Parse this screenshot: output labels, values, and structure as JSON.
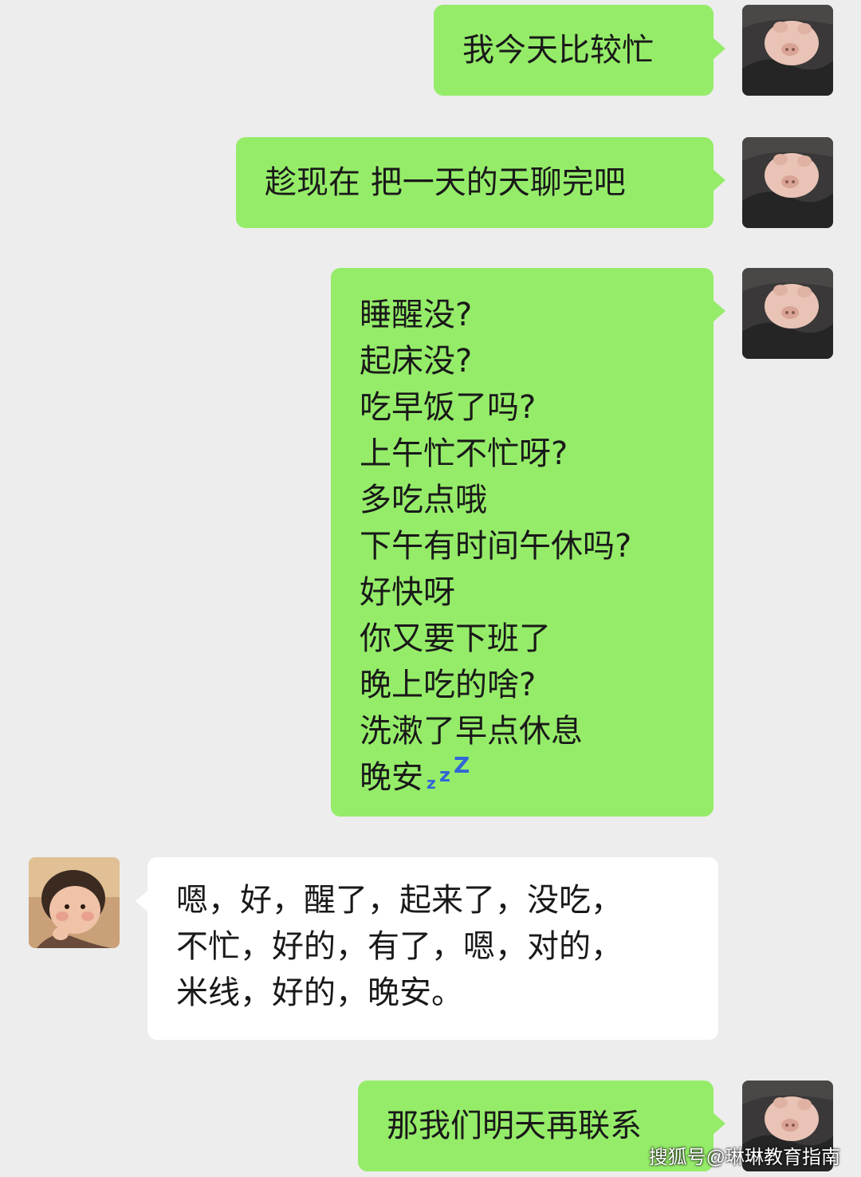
{
  "messages": [
    {
      "sender": "me",
      "text": "我今天比较忙"
    },
    {
      "sender": "me",
      "text": "趁现在 把一天的天聊完吧"
    },
    {
      "sender": "me",
      "lines": [
        "睡醒没?",
        "起床没?",
        "吃早饭了吗?",
        "上午忙不忙呀?",
        "多吃点哦",
        "下午有时间午休吗?",
        "好快呀",
        "你又要下班了",
        "晚上吃的啥?",
        "洗漱了早点休息",
        "晚安"
      ],
      "trailing_icon": "sleeping-zzz-icon"
    },
    {
      "sender": "other",
      "lines": [
        "嗯，好，醒了，起来了，没吃，",
        "不忙，好的，有了，嗯，对的，",
        "米线，好的，晚安。"
      ]
    },
    {
      "sender": "me",
      "text": "那我们明天再联系"
    }
  ],
  "watermark": "搜狐号@琳琳教育指南",
  "colors": {
    "background": "#ededed",
    "sent_bubble": "#95ec69",
    "received_bubble": "#ffffff",
    "zzz": "#2f66d6"
  }
}
